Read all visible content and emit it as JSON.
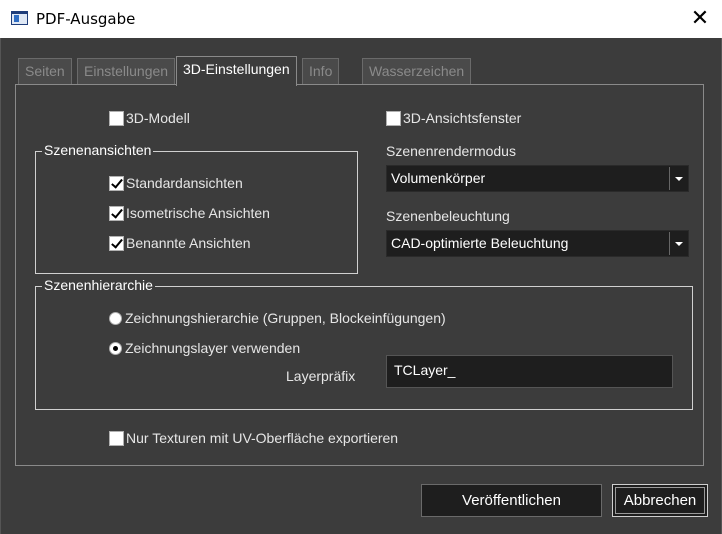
{
  "window": {
    "title": "PDF-Ausgabe"
  },
  "tabs": [
    {
      "label": "Seiten",
      "active": false
    },
    {
      "label": "Einstellungen",
      "active": false
    },
    {
      "label": "3D-Einstellungen",
      "active": true
    },
    {
      "label": "Info",
      "active": false
    },
    {
      "label": "Wasserzeichen",
      "active": false
    }
  ],
  "options": {
    "model_3d": {
      "label": "3D-Modell",
      "checked": false
    },
    "view_window_3d": {
      "label": "3D-Ansichtsfenster",
      "checked": false
    },
    "uv_textures": {
      "label": "Nur Texturen mit UV-Oberfläche exportieren",
      "checked": false
    }
  },
  "scene_views": {
    "title": "Szenenansichten",
    "items": [
      {
        "label": "Standardansichten",
        "checked": true
      },
      {
        "label": "Isometrische Ansichten",
        "checked": true
      },
      {
        "label": "Benannte Ansichten",
        "checked": true
      }
    ]
  },
  "render_mode": {
    "label": "Szenenrendermodus",
    "value": "Volumenkörper"
  },
  "lighting": {
    "label": "Szenenbeleuchtung",
    "value": "CAD-optimierte Beleuchtung"
  },
  "hierarchy": {
    "title": "Szenenhierarchie",
    "options": [
      {
        "label": "Zeichnungshierarchie (Gruppen, Blockeinfügungen)",
        "selected": false
      },
      {
        "label": "Zeichnungslayer verwenden",
        "selected": true
      }
    ],
    "prefix_label": "Layerpräfix",
    "prefix_value": "TCLayer_"
  },
  "buttons": {
    "publish": "Veröffentlichen",
    "cancel": "Abbrechen"
  },
  "colors": {
    "background": "#3c3c3c",
    "field": "#1e1e1e",
    "titlebar": "#ffffff"
  }
}
